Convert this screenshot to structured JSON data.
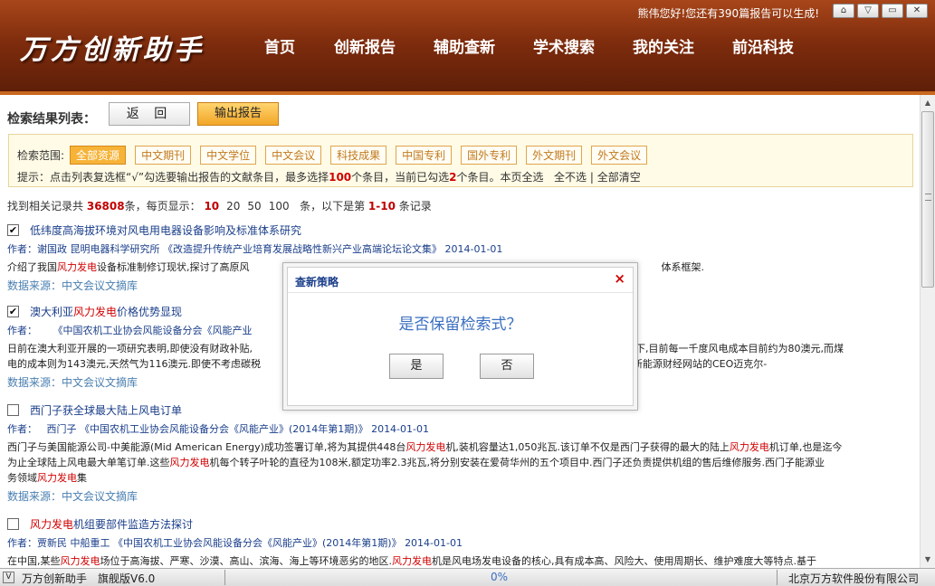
{
  "header": {
    "logo": "万方创新助手",
    "nav": [
      "首页",
      "创新报告",
      "辅助查新",
      "学术搜索",
      "我的关注",
      "前沿科技"
    ],
    "user_prefix": "熊伟您好!您还有",
    "user_count": "390",
    "user_suffix": "篇报告可以生成!",
    "window_buttons": [
      "home-icon",
      "chevron-down-icon",
      "minimize-icon",
      "close-icon"
    ]
  },
  "toolbar": {
    "title": "检索结果列表：",
    "back_label": "返 回",
    "export_label": "输出报告"
  },
  "filter": {
    "label": "检索范围:",
    "tags": [
      "全部资源",
      "中文期刊",
      "中文学位",
      "中文会议",
      "科技成果",
      "中国专利",
      "国外专利",
      "外文期刊",
      "外文会议"
    ],
    "active_index": 0,
    "hint_prefix": "提示：点击列表复选框“",
    "check_mark": "√",
    "hint_mid1": "”勾选要输出报告的文献条目，最多选择",
    "max": "100",
    "hint_mid2": "个条目，当前已勾选",
    "selected": "2",
    "hint_mid3": "个条目。本页全选",
    "unselect_all": "全不选",
    "sep": "|",
    "clear_all": "全部清空"
  },
  "stats": {
    "prefix": "找到相关记录共",
    "total": "36808",
    "mid": "条，每页显示：",
    "page_sizes": [
      "10",
      "20",
      "50",
      "100"
    ],
    "suffix1": "条，以下是第",
    "range": "1-10",
    "suffix2": "条记录"
  },
  "results": [
    {
      "checked": true,
      "title": "低纬度高海拔环境对风电用电器设备影响及标准体系研究",
      "meta_label": "作者：",
      "meta": "谢国政  昆明电器科学研究所  《改造提升传统产业培育发展战略性新兴产业高端论坛论文集》 2014-01-01",
      "desc_a": "介绍了我国",
      "desc_kw": "风力发电",
      "desc_b": "设备标准制修订现状,探讨了高原风",
      "desc_c": "体系框架.",
      "source": "数据来源：中文会议文摘库"
    },
    {
      "checked": true,
      "title_a": "澳大利亚",
      "title_kw": "风力发电",
      "title_b": "价格优势显现",
      "meta_label": "作者：",
      "meta": "《中国农机工业协会风能设备分会《风能产业",
      "desc_a": "日前在澳大利亚开展的一项研究表明,即使没有财政补贴,",
      "desc_c": "体制之下,目前每一千度风电成本目前约为80澳元,而煤",
      "desc2_a": "电的成本则为143澳元,天然气为116澳元.即使不考虑碳税",
      "desc2_c": "社新能源财经网站的CEO迈克尔-",
      "source": "数据来源：中文会议文摘库"
    },
    {
      "checked": false,
      "title": "西门子获全球最大陆上风电订单",
      "meta_label": "作者：",
      "meta": "西门子  《中国农机工业协会风能设备分会《风能产业》(2014年第1期)》 2014-01-01",
      "desc_a": "西门子与美国能源公司-中美能源(Mid American Energy)成功签署订单,将为其提供448台",
      "desc_kw": "风力发电",
      "desc_b": "机,装机容量达1,050兆瓦.该订单不仅是西门子获得的最大的陆上",
      "desc_kw2": "风力发电",
      "desc_c": "机订单,也是迄今",
      "desc2_a": "为止全球陆上风电最大单笔订单.这些",
      "desc2_kw": "风力发电",
      "desc2_b": "机每个转子叶轮的直径为108米,额定功率2.3兆瓦,将分别安装在爱荷华州的五个项目中.西门子还负责提供机组的售后维修服务.西门子能源业",
      "desc3_a": "务领域",
      "desc3_kw": "风力发电",
      "desc3_b": "集",
      "source": "数据来源：中文会议文摘库"
    },
    {
      "checked": false,
      "title_kw": "风力发电",
      "title_b": "机组要部件监造方法探讨",
      "meta_label": "作者：",
      "meta": "贾新民  中船重工  《中国农机工业协会风能设备分会《风能产业》(2014年第1期)》 2014-01-01",
      "desc_a": "在中国,某些",
      "desc_kw": "风力发电",
      "desc_b": "场位于高海拔、严寒、沙漠、高山、滨海、海上等环境恶劣的地区.",
      "desc_kw2": "风力发电",
      "desc_c": "机是风电场发电设备的核心,具有成本高、风险大、使用周期长、维护难度大等特点.基于"
    }
  ],
  "dialog": {
    "title": "查新策略",
    "close": "×",
    "question": "是否保留检索式？",
    "yes": "是",
    "no": "否"
  },
  "statusbar": {
    "toggle": "V",
    "app": "万方创新助手",
    "version": "旗舰版V6.0",
    "progress": "0%",
    "company": "北京万方软件股份有限公司"
  }
}
